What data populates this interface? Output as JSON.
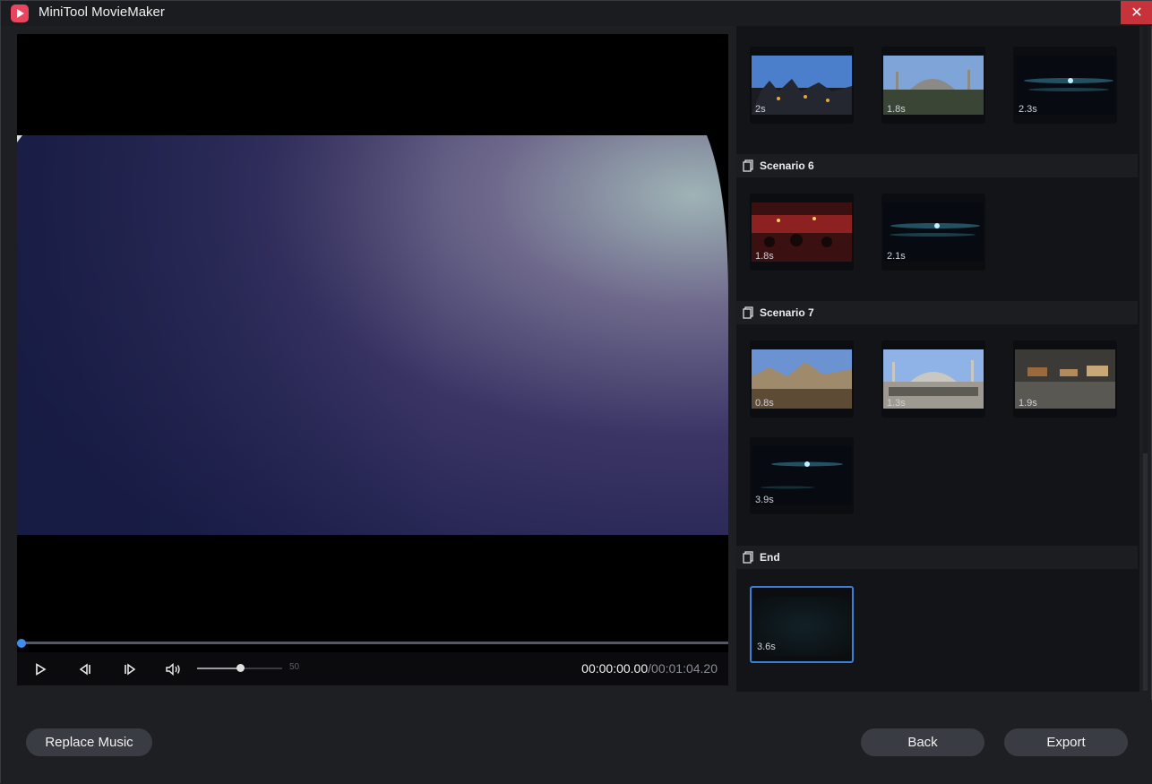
{
  "app": {
    "title": "MiniTool MovieMaker",
    "close_glyph": "✕"
  },
  "player": {
    "progress": 0,
    "volume": 50,
    "volume_label": "50",
    "time_current": "00:00:00.00",
    "time_total": "/00:01:04.20",
    "icons": [
      "play-icon",
      "prev-frame-icon",
      "next-frame-icon",
      "volume-icon"
    ]
  },
  "panel": {
    "top_durations": [
      "2s",
      "1.8s",
      "2.3s"
    ],
    "scenario6": {
      "label": "Scenario 6",
      "durations": [
        "1.8s",
        "2.1s"
      ]
    },
    "scenario7": {
      "label": "Scenario 7",
      "durations": [
        "0.8s",
        "1.3s",
        "1.9s",
        "3.9s"
      ]
    },
    "end": {
      "label": "End",
      "durations": [
        "3.6s"
      ]
    }
  },
  "bottom": {
    "replace_music": "Replace Music",
    "back": "Back",
    "export": "Export"
  },
  "colors": {
    "accent": "#3d8cf0",
    "close": "#c8333b",
    "panel_bg": "#131417"
  }
}
